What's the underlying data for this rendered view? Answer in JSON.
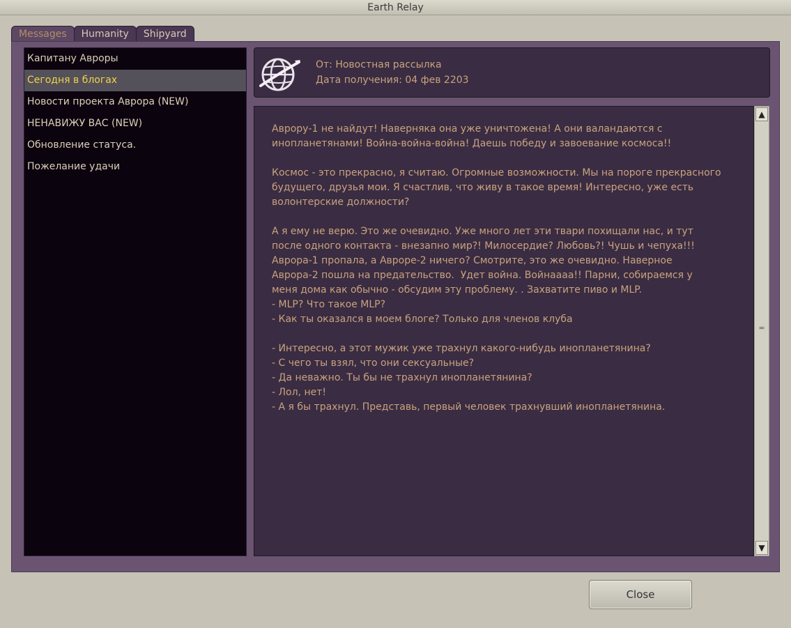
{
  "window": {
    "title": "Earth Relay"
  },
  "tabs": [
    {
      "label": "Messages",
      "active": true
    },
    {
      "label": "Humanity",
      "active": false
    },
    {
      "label": "Shipyard",
      "active": false
    }
  ],
  "messages": [
    {
      "label": "Капитану Авроры"
    },
    {
      "label": "Сегодня в блогах",
      "selected": true
    },
    {
      "label": "Новости проекта Аврора (NEW)"
    },
    {
      "label": "НЕНАВИЖУ ВАС (NEW)"
    },
    {
      "label": "Обновление статуса."
    },
    {
      "label": "Пожелание удачи"
    }
  ],
  "header": {
    "from": "От: Новостная рассылка",
    "date": "Дата получения: 04 фев 2203",
    "icon": "globe-icon"
  },
  "body": {
    "text": "Аврору-1 не найдут! Наверняка она уже уничтожена! А они валандаются с\nинопланетянами! Война-война-война! Даешь победу и завоевание космоса!!\n\nКосмос - это прекрасно, я считаю. Огромные возможности. Мы на пороге прекрасного\nбудущего, друзья мои. Я счастлив, что живу в такое время! Интересно, уже есть\nволонтерские должности?\n\nА я ему не верю. Это же очевидно. Уже много лет эти твари похищали нас, и тут\nпосле одного контакта - внезапно мир?! Милосердие? Любовь?! Чушь и чепуха!!!\nАврора-1 пропала, а Авроре-2 ничего? Смотрите, это же очевидно. Наверное\nАврора-2 пошла на предательство.  Удет война. Войнаааа!! Парни, собираемся у\nменя дома как обычно - обсудим эту проблему. . Захватите пиво и MLP.\n- MLP? Что такое MLP?\n- Как ты оказался в моем блоге? Только для членов клуба\n\n- Интересно, а этот мужик уже трахнул какого-нибудь инопланетянина?\n- С чего ты взял, что они сексуальные?\n- Да неважно. Ты бы не трахнул инопланетянина?\n- Лол, нет!\n- А я бы трахнул. Представь, первый человек трахнувший инопланетянина."
  },
  "scrollbar": {
    "up_arrow": "▲",
    "down_arrow": "▼",
    "grip": "="
  },
  "footer": {
    "close_label": "Close"
  },
  "colors": {
    "frame": "#6a5472",
    "list_bg": "#0b030e",
    "selected_text": "#f0d34a",
    "message_text": "#c9a37f"
  }
}
